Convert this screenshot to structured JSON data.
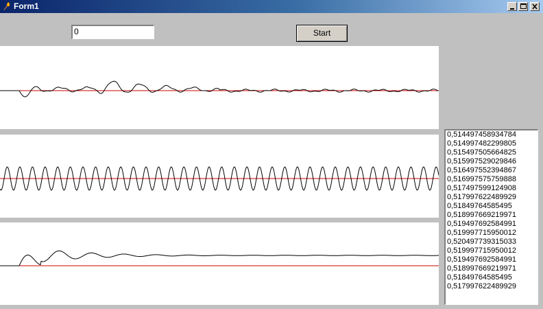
{
  "window": {
    "title": "Form1",
    "icon": "flame-icon",
    "buttons": [
      "minimize-icon",
      "maximize-icon",
      "close-icon"
    ]
  },
  "edit": {
    "value": "0"
  },
  "start_button": {
    "label": "Start"
  },
  "plots": [
    {
      "name": "plot-1",
      "baseline_color": "#cc0000",
      "line_color": "#000000"
    },
    {
      "name": "plot-2",
      "baseline_color": "#cc0000",
      "line_color": "#000000"
    },
    {
      "name": "plot-3",
      "baseline_color": "#cc0000",
      "line_color": "#000000"
    }
  ],
  "list": {
    "items": [
      "0,514497458934784",
      "0,514997482299805",
      "0,515497505664825",
      "0,515997529029846",
      "0,516497552394867",
      "0,516997575759888",
      "0,517497599124908",
      "0,517997622489929",
      "0,51849764585495",
      "0,518997669219971",
      "0,519497692584991",
      "0,519997715950012",
      "0,520497739315033",
      "0,519997715950012",
      "0,519497692584991",
      "0,518997669219971",
      "0,51849764585495",
      "0,517997622489929"
    ]
  }
}
